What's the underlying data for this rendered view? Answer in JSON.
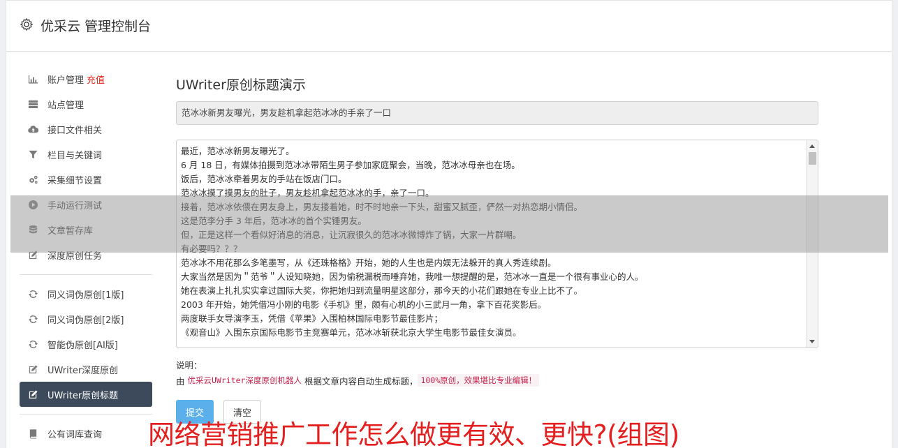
{
  "header": {
    "title": "优采云 管理控制台",
    "icon": "gear-icon"
  },
  "sidebar": {
    "group1": [
      {
        "label": "账户管理",
        "badge": "充值",
        "icon": "bar-chart-icon"
      },
      {
        "label": "站点管理",
        "icon": "server-icon"
      },
      {
        "label": "接口文件相关",
        "icon": "cloud-upload-icon"
      },
      {
        "label": "栏目与关键词",
        "icon": "filter-icon"
      },
      {
        "label": "采集细节设置",
        "icon": "cogs-icon"
      },
      {
        "label": "手动运行测试",
        "icon": "play-circle-icon"
      },
      {
        "label": "文章暂存库",
        "icon": "database-icon"
      },
      {
        "label": "深度原创任务",
        "icon": "edit-icon"
      }
    ],
    "group2": [
      {
        "label": "同义词伪原创[1版]",
        "icon": "refresh-icon"
      },
      {
        "label": "同义词伪原创[2版]",
        "icon": "refresh-icon"
      },
      {
        "label": "智能伪原创[AI版]",
        "icon": "refresh-icon"
      },
      {
        "label": "UWriter深度原创",
        "icon": "edit-icon"
      },
      {
        "label": "UWriter原创标题",
        "icon": "edit-icon",
        "active": true
      }
    ],
    "group3": [
      {
        "label": "公有词库查询",
        "icon": "book-icon"
      }
    ]
  },
  "main": {
    "heading": "UWriter原创标题演示",
    "title_value": "范冰冰新男友曝光，男友趁机拿起范冰冰的手亲了一口",
    "content_lines": [
      "最近，范冰冰新男友曝光了。",
      "6 月 18 日，有媒体拍摄到范冰冰带陌生男子参加家庭聚会，当晚，范冰冰母亲也在场。",
      "饭后，范冰冰牵着男友的手站在饭店门口。",
      "范冰冰摸了摸男友的肚子，男友趁机拿起范冰冰的手，亲了一口。",
      "接着，范冰冰依偎在男友身上，男友搂着她，时不时地亲一下头，甜蜜又腻歪，俨然一对热恋期小情侣。",
      "这是范李分手 3 年后，范冰冰的首个实锤男友。",
      "但，正是这样一个看似好消息的消息，让沉寂很久的范冰冰微博炸了锅，大家一片群嘲。",
      "有必要吗？？？",
      "范冰冰不用花那么多笔墨写，从《还珠格格》开始，她的人生也是内娱无法躲开的真人秀连续剧。",
      "大家当然是因为＂范爷＂人设知晓她，因为偷税漏税而唾弃她，我唯一想提醒的是，范冰冰一直是一个很有事业心的人。",
      "她在表演上扎扎实实拿过国际大奖，你把她归到流量明星这部分，那今天的小花们跟她在专业上比不了。",
      "2003 年开始，她凭借冯小刚的电影《手机》里，颇有心机的小三武月一角，拿下百花奖影后。",
      "两度联手女导演李玉，凭借《苹果》入围柏林国际电影节最佳影片；",
      "《观音山》入围东京国际电影节主竞赛单元，范冰冰斩获北京大学生电影节最佳女演员。"
    ],
    "note_label": "说明：",
    "note_prefix": "由",
    "note_product": "优采云UWriter深度原创机器人",
    "note_middle": "根据文章内容自动生成标题，",
    "note_highlight": "100%原创，效果堪比专业编辑！",
    "submit_label": "提交",
    "clear_label": "清空"
  },
  "overlay_caption": "网络营销推广工作怎么做更有效、更快?(组图)"
}
